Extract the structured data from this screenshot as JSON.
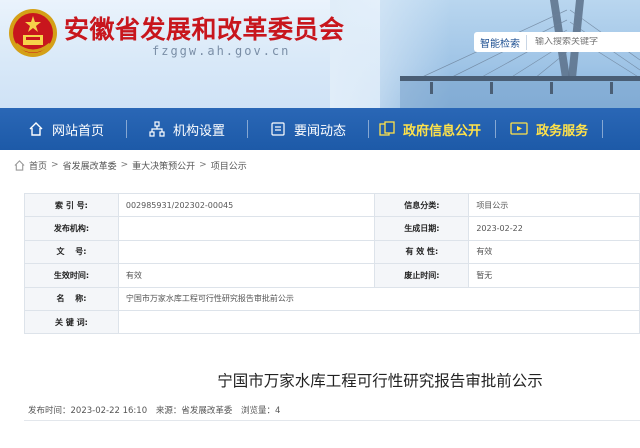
{
  "header": {
    "site_title": "安徽省发展和改革委员会",
    "site_domain": "fzggw.ah.gov.cn",
    "advanced_search_label": "智能检索",
    "search_placeholder": "输入搜索关键字"
  },
  "nav": {
    "items": [
      {
        "label": "网站首页",
        "icon": "home-icon"
      },
      {
        "label": "机构设置",
        "icon": "org-chart-icon"
      },
      {
        "label": "要闻动态",
        "icon": "news-icon"
      },
      {
        "label": "政府信息公开",
        "icon": "info-disclosure-icon"
      },
      {
        "label": "政务服务",
        "icon": "service-icon"
      }
    ],
    "active_color": "#ffe24a"
  },
  "breadcrumb": {
    "items": [
      "首页",
      "省发展改革委",
      "重大决策预公开",
      "项目公示"
    ],
    "separator": ">"
  },
  "info_table": {
    "rows": [
      {
        "label1": "索 引 号:",
        "value1": "002985931/202302-00045",
        "label2": "信息分类:",
        "value2": "项目公示"
      },
      {
        "label1": "发布机构:",
        "value1": "",
        "label2": "生成日期:",
        "value2": "2023-02-22"
      },
      {
        "label1": "文　 号:",
        "value1": "",
        "label2": "有 效 性:",
        "value2": "有效"
      },
      {
        "label1": "生效时间:",
        "value1": "有效",
        "label2": "废止时间:",
        "value2": "暂无"
      },
      {
        "label1": "名　 称:",
        "value1": "宁国市万家水库工程可行性研究报告审批前公示"
      },
      {
        "label1": "关 键 词:",
        "value1": ""
      }
    ]
  },
  "article": {
    "title": "宁国市万家水库工程可行性研究报告审批前公示",
    "meta": {
      "publish_time": "发布时间：2023-02-22 16:10",
      "source": "来源：省发展改革委",
      "views": "浏览量：4"
    }
  },
  "colors": {
    "brand_red": "#c8161d",
    "nav_blue": "#1d5aa8"
  }
}
